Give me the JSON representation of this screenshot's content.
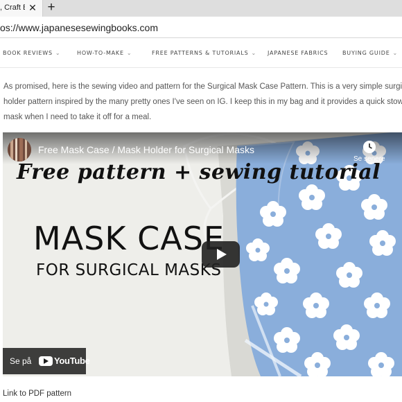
{
  "browser": {
    "tab_title": ", Craft B",
    "tab_close": "✕",
    "new_tab": "+",
    "url": "os://www.japanesesewingbooks.com"
  },
  "nav": {
    "items": [
      {
        "label": "BOOK REVIEWS",
        "has_dropdown": true
      },
      {
        "label": "HOW-TO-MAKE",
        "has_dropdown": true
      },
      {
        "label": "FREE PATTERNS & TUTORIALS",
        "has_dropdown": true
      },
      {
        "label": "JAPANESE FABRICS",
        "has_dropdown": false
      },
      {
        "label": "BUYING GUIDE",
        "has_dropdown": true
      }
    ],
    "chevron": "⌄"
  },
  "article": {
    "intro_lines": [
      "As promised, here is the sewing video and pattern for the Surgical Mask Case Pattern. This is a very simple surgical m",
      "holder pattern inspired by the many pretty ones I've seen on IG. I keep this in my bag and it provides a quick stowaw",
      "mask when I need to take it off for a meal."
    ],
    "pdf_link": "Link to PDF pattern"
  },
  "video": {
    "title": "Free Mask Case / Mask Holder for Surgical Masks",
    "watch_later_label": "Se senere",
    "headline": "Free pattern + sewing tutorial",
    "big_title": "MASK CASE",
    "sub_title": "FOR SURGICAL MASKS",
    "watch_on_label": "Se på",
    "youtube_wordmark": "YouTube"
  },
  "colors": {
    "fabric_blue": "#8aaedb",
    "flower_white": "#ffffff",
    "video_bg": "#eeeeea"
  }
}
